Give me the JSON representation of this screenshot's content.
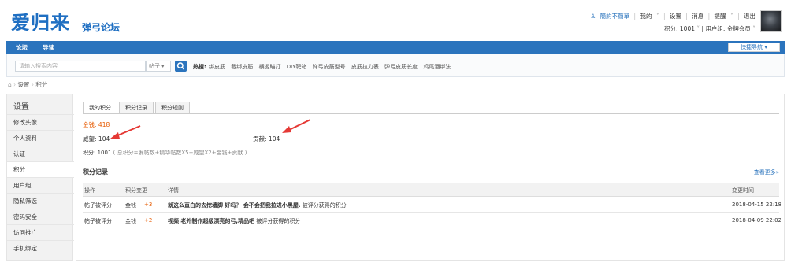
{
  "header": {
    "logo_main": "爱归来",
    "logo_sub": "弹弓论坛",
    "user_links": [
      "簡約不簡單",
      "我的",
      "设置",
      "消息",
      "提醒",
      "退出"
    ],
    "points_text": "积分: 1001",
    "usergroup_text": "用户组: 金牌会员"
  },
  "nav": {
    "items": [
      "论坛",
      "导读"
    ],
    "quick_nav": "快捷导航"
  },
  "search": {
    "placeholder": "请输入搜索内容",
    "type": "帖子",
    "hot_label": "热搜:",
    "hot_links": [
      "绑皮筋",
      "截绑皮筋",
      "横握瞄打",
      "DIY靶箱",
      "弹弓皮筋型号",
      "皮筋拉力表",
      "弹弓皮筋长度",
      "鸡尾酒绑法"
    ]
  },
  "breadcrumb": [
    "设置",
    "积分"
  ],
  "sidebar": {
    "title": "设置",
    "items": [
      "修改头像",
      "个人资料",
      "认证",
      "积分",
      "用户组",
      "隐私筛选",
      "密码安全",
      "访问推广",
      "手机绑定"
    ],
    "active_index": 3
  },
  "tabs": [
    "我的积分",
    "积分记录",
    "积分规则"
  ],
  "stats": {
    "money_label": "金钱:",
    "money_value": "418",
    "weiwang_label": "威望:",
    "weiwang_value": "104",
    "gongxian_label": "贡献:",
    "gongxian_value": "104",
    "formula_prefix": "积分: 1001",
    "formula": "( 总积分=发帖数+精华帖数X5+威望X2+金钱+贡献 )"
  },
  "records": {
    "title": "积分记录",
    "more": "查看更多»",
    "columns": [
      "操作",
      "积分变更",
      "详情",
      "变更时间"
    ],
    "rows": [
      {
        "op": "帖子被评分",
        "type": "金钱",
        "value": "+3",
        "detail_bold": "就这么直白的去挖墙脚 好吗？ 会不会把我拉进小黑屋.",
        "detail_rest": " 被评分获得的积分",
        "time": "2018-04-15 22:18"
      },
      {
        "op": "帖子被评分",
        "type": "金钱",
        "value": "+2",
        "detail_bold": "视频 老外制作超级漂亮的弓,精品吧",
        "detail_rest": " 被评分获得的积分",
        "time": "2018-04-09 22:02"
      }
    ]
  },
  "colors": {
    "brand_blue": "#2b74bd",
    "accent_orange": "#e65a00",
    "arrow_red": "#e53935"
  }
}
